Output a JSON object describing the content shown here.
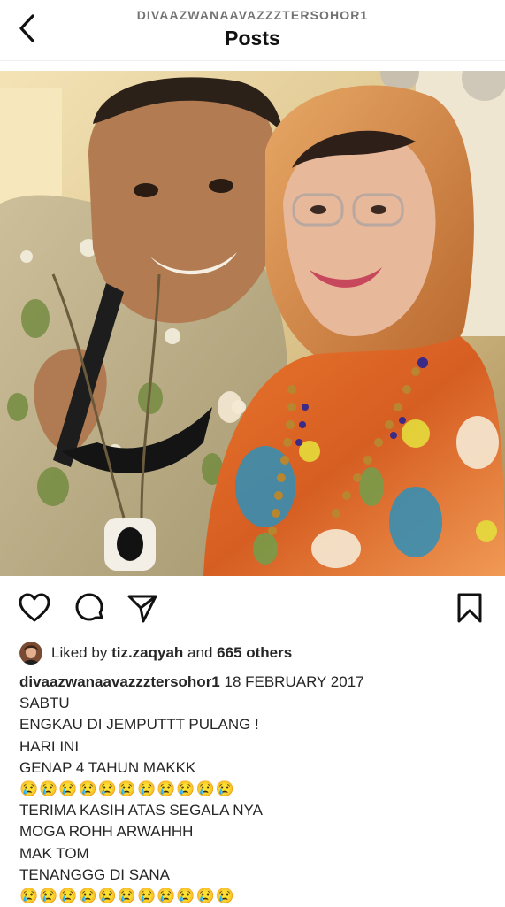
{
  "header": {
    "username": "DIVAAZWANAAVAZZZTERSOHOR1",
    "title": "Posts",
    "back_icon": "chevron-left-icon"
  },
  "post": {
    "image": "photo of a man in a batik shirt holding sunglasses next to an elderly woman in a headscarf and floral blouse",
    "actions": {
      "like_icon": "heart-icon",
      "comment_icon": "comment-icon",
      "share_icon": "send-icon",
      "save_icon": "bookmark-icon"
    },
    "likes": {
      "prefix": "Liked by ",
      "user": "tiz.zaqyah",
      "middle": " and ",
      "others": "665 others"
    },
    "caption": {
      "username": "divaazwanaavazzztersohor1",
      "lines": [
        " 18 FEBRUARY 2017",
        "SABTU",
        "ENGKAU DI JEMPUTTT PULANG !",
        "HARI INI",
        "GENAP 4 TAHUN MAKKK",
        "😢😢😢😢😢😢😢😢😢😢😢",
        "TERIMA KASIH ATAS SEGALA NYA",
        "MOGA ROHH ARWAHHH",
        "MAK TOM",
        "TENANGGG DI SANA",
        "😢😢😢😢😢😢😢😢😢😢😢"
      ]
    }
  },
  "colors": {
    "text": "#262626",
    "muted": "#737373",
    "divider": "#efefef"
  }
}
